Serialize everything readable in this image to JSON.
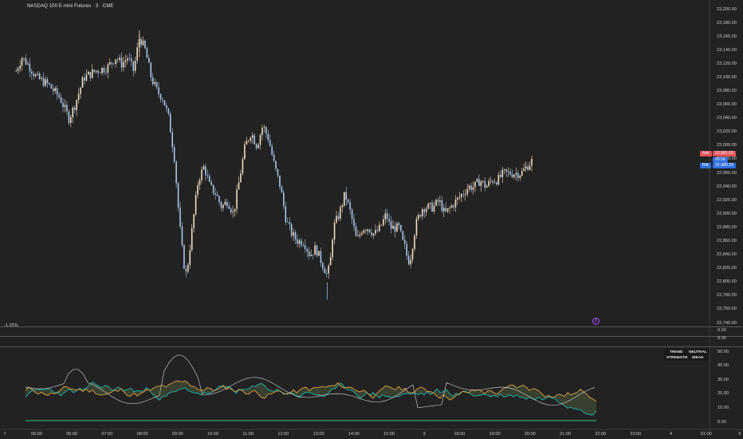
{
  "header": {
    "instrument": "NASDAQ 100 E-mini Futures · 3 · CME"
  },
  "price_axis": {
    "ticks": [
      "23,200.00",
      "23,180.00",
      "23,160.00",
      "23,140.00",
      "23,120.00",
      "23,100.00",
      "23,080.00",
      "23,060.00",
      "23,040.00",
      "23,020.00",
      "23,000.00",
      "22,980.00",
      "22,960.00",
      "22,940.00",
      "22,920.00",
      "22,900.00",
      "22,880.00",
      "22,860.00",
      "22,840.00",
      "22,820.00",
      "22,800.00",
      "22,780.00",
      "22,760.00",
      "22,740.00"
    ],
    "ask_label": "Ask",
    "ask_value": "22,981.00",
    "countdown": "00:56",
    "bid_label": "Bid",
    "bid_value": "22,980.25",
    "ask_color": "#e5535b",
    "bid_color": "#2f6fe0",
    "countdown_color": "#2f6fe0"
  },
  "corner_percent": "-1.25%",
  "marker_glyph": "ʃ",
  "pane2_axis": [
    "0.00"
  ],
  "pane3_axis": [
    "0.00"
  ],
  "oscillator_axis": [
    "50.00",
    "40.00",
    "30.00",
    "20.00",
    "10.00",
    "0.00"
  ],
  "indicator_table": {
    "row1_label": "TREND",
    "row1_value": "NEUTRAL",
    "row2_label": "STRENGTH",
    "row2_value": "WEAK"
  },
  "time_axis": {
    "left_edge": "7",
    "labels": [
      "05:00",
      "06:00",
      "07:00",
      "08:00",
      "09:00",
      "10:00",
      "11:00",
      "12:00",
      "13:00",
      "14:00",
      "15:00",
      "3",
      "18:00",
      "19:00",
      "20:00",
      "21:00",
      "22:00",
      "23:00",
      "4",
      "01:00"
    ],
    "right_edge": "6"
  },
  "colors": {
    "background": "#222222",
    "up_candle": "#f1dcc0",
    "down_candle": "#a9c6ea",
    "osc_line_orange": "#e0a040",
    "osc_line_teal": "#19b6b0",
    "osc_line_white": "#d9d9d9"
  },
  "chart_data": {
    "type": "candlestick",
    "title": "NASDAQ 100 E-mini Futures · 3 · CME",
    "ylim": [
      22740,
      23200
    ],
    "x_labels": [
      "05:00",
      "06:00",
      "07:00",
      "08:00",
      "09:00",
      "10:00",
      "11:00",
      "12:00",
      "13:00",
      "14:00",
      "15:00",
      "3",
      "18:00",
      "19:00",
      "20:00",
      "21:00",
      "22:00"
    ],
    "close_path": [
      [
        "04:25",
        23110
      ],
      [
        "04:35",
        23130
      ],
      [
        "04:45",
        23120
      ],
      [
        "05:00",
        23100
      ],
      [
        "05:20",
        23090
      ],
      [
        "05:40",
        23070
      ],
      [
        "05:55",
        23040
      ],
      [
        "06:05",
        23060
      ],
      [
        "06:20",
        23100
      ],
      [
        "06:40",
        23110
      ],
      [
        "07:00",
        23115
      ],
      [
        "07:15",
        23130
      ],
      [
        "07:25",
        23120
      ],
      [
        "07:35",
        23130
      ],
      [
        "07:45",
        23110
      ],
      [
        "07:55",
        23160
      ],
      [
        "08:05",
        23140
      ],
      [
        "08:15",
        23100
      ],
      [
        "08:25",
        23080
      ],
      [
        "08:35",
        23070
      ],
      [
        "08:45",
        23040
      ],
      [
        "08:55",
        22980
      ],
      [
        "09:00",
        22920
      ],
      [
        "09:05",
        22870
      ],
      [
        "09:10",
        22830
      ],
      [
        "09:15",
        22810
      ],
      [
        "09:25",
        22880
      ],
      [
        "09:35",
        22950
      ],
      [
        "09:45",
        22970
      ],
      [
        "09:55",
        22940
      ],
      [
        "10:05",
        22930
      ],
      [
        "10:15",
        22910
      ],
      [
        "10:25",
        22920
      ],
      [
        "10:35",
        22900
      ],
      [
        "10:45",
        22950
      ],
      [
        "10:55",
        23000
      ],
      [
        "11:05",
        23020
      ],
      [
        "11:15",
        23000
      ],
      [
        "11:25",
        23030
      ],
      [
        "11:35",
        23010
      ],
      [
        "11:45",
        22970
      ],
      [
        "11:55",
        22940
      ],
      [
        "12:05",
        22890
      ],
      [
        "12:15",
        22870
      ],
      [
        "12:25",
        22860
      ],
      [
        "12:35",
        22860
      ],
      [
        "12:45",
        22840
      ],
      [
        "12:55",
        22850
      ],
      [
        "13:05",
        22830
      ],
      [
        "13:15",
        22810
      ],
      [
        "13:20",
        22830
      ],
      [
        "13:25",
        22880
      ],
      [
        "13:35",
        22900
      ],
      [
        "13:45",
        22930
      ],
      [
        "13:55",
        22900
      ],
      [
        "14:05",
        22860
      ],
      [
        "14:15",
        22880
      ],
      [
        "14:25",
        22880
      ],
      [
        "14:35",
        22870
      ],
      [
        "14:45",
        22880
      ],
      [
        "14:55",
        22900
      ],
      [
        "15:05",
        22880
      ],
      [
        "15:15",
        22880
      ],
      [
        "15:25",
        22880
      ],
      [
        "15:35",
        22880
      ],
      [
        "15:45",
        22860
      ],
      [
        "15:55",
        22850
      ],
      [
        "16:05",
        22830
      ],
      [
        "16:15",
        22840
      ],
      [
        "16:25",
        22870
      ],
      [
        "16:35",
        22890
      ],
      [
        "16:45",
        22900
      ],
      [
        "16:55",
        22910
      ],
      [
        "17:05",
        22910
      ],
      [
        "17:15",
        22910
      ],
      [
        "17:25",
        22920
      ],
      [
        "17:35",
        22900
      ],
      [
        "17:45",
        22910
      ],
      [
        "17:55",
        22920
      ],
      [
        "18:05",
        22930
      ],
      [
        "18:15",
        22940
      ],
      [
        "18:25",
        22940
      ],
      [
        "18:35",
        22950
      ],
      [
        "18:45",
        22940
      ],
      [
        "18:55",
        22950
      ],
      [
        "19:05",
        22950
      ],
      [
        "19:15",
        22960
      ],
      [
        "19:25",
        22960
      ],
      [
        "19:35",
        22960
      ],
      [
        "19:45",
        22960
      ],
      [
        "19:55",
        22970
      ],
      [
        "20:05",
        22980
      ]
    ],
    "extremes": {
      "high": 23170,
      "low": 22775
    },
    "last": 22980.25,
    "ask": 22981.0,
    "bid": 22980.25
  }
}
